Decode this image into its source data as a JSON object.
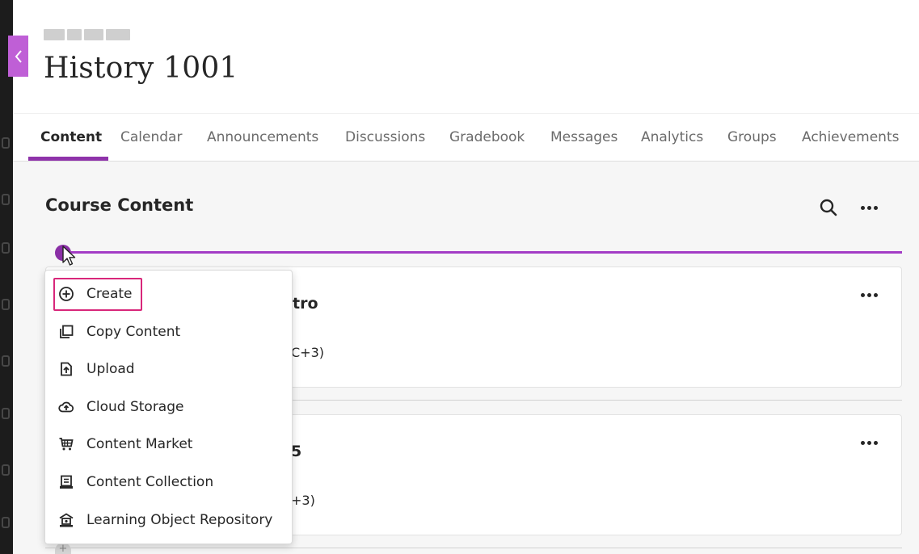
{
  "course": {
    "title": "History 1001"
  },
  "tabs": [
    {
      "label": "Content",
      "active": true
    },
    {
      "label": "Calendar",
      "active": false
    },
    {
      "label": "Announcements",
      "active": false
    },
    {
      "label": "Discussions",
      "active": false
    },
    {
      "label": "Gradebook",
      "active": false
    },
    {
      "label": "Messages",
      "active": false
    },
    {
      "label": "Analytics",
      "active": false
    },
    {
      "label": "Groups",
      "active": false
    },
    {
      "label": "Achievements",
      "active": false
    }
  ],
  "main": {
    "section_title": "Course Content",
    "search_icon": "search-icon",
    "more_icon": "more-options-icon",
    "cards": [
      {
        "title_partial": "tro",
        "subtitle_partial": "C+3)"
      },
      {
        "title_partial": "5",
        "subtitle_partial": "+3)"
      }
    ]
  },
  "menu": {
    "items": [
      {
        "label": "Create",
        "icon": "plus-circle-icon",
        "highlighted": true
      },
      {
        "label": "Copy Content",
        "icon": "copy-icon"
      },
      {
        "label": "Upload",
        "icon": "upload-icon"
      },
      {
        "label": "Cloud Storage",
        "icon": "cloud-upload-icon"
      },
      {
        "label": "Content Market",
        "icon": "cart-icon"
      },
      {
        "label": "Content Collection",
        "icon": "archive-icon"
      },
      {
        "label": "Learning Object Repository",
        "icon": "repository-icon"
      }
    ]
  },
  "colors": {
    "accent": "#8f33aa",
    "back_tab": "#bf5fd6",
    "highlight_border": "#d8277a",
    "content_bg": "#f6f6f6"
  }
}
